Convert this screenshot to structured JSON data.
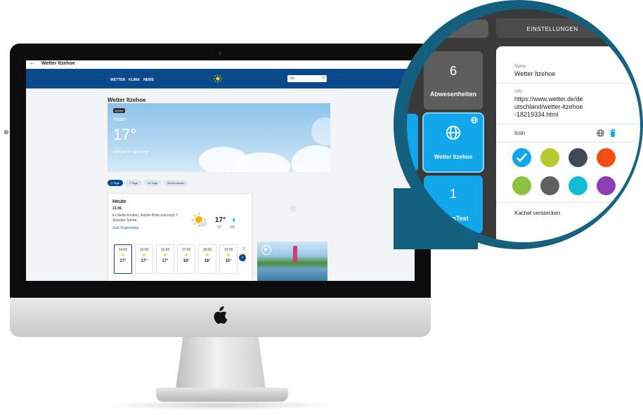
{
  "screen": {
    "topbar": {
      "back_icon": "arrow-left-icon",
      "title": "Wetter Itzehoe"
    },
    "nav": {
      "links": [
        "WETTER",
        "KLIMA",
        "NEWS"
      ],
      "logo_icon": "sun-icon",
      "search_placeholder": "Ort"
    },
    "page_title": "Wetter Itzehoe",
    "hero": {
      "badge": "● jetzt",
      "condition": "heiter",
      "temperature": "17°",
      "feels_like": "fühlt sich 4° wärmer an"
    },
    "chips": [
      "3 Tage",
      "7 Tage",
      "14 Tage",
      "Wochenende"
    ],
    "today": {
      "title": "Heute",
      "date": "13.06.",
      "description": "Es bleibt trocken, leichte Brise und noch 7 Stunden Sonne.",
      "link": "Zum Regenradar",
      "high": "17°",
      "low": "11°",
      "rain_chance": "0%"
    },
    "hours": [
      {
        "time": "14:00",
        "temp": "17°"
      },
      {
        "time": "15:00",
        "temp": "17°"
      },
      {
        "time": "16:00",
        "temp": "17°"
      },
      {
        "time": "17:00",
        "temp": "16°"
      },
      {
        "time": "18:00",
        "temp": "16°"
      },
      {
        "time": "19:00",
        "temp": "15°"
      },
      {
        "time": "2",
        "temp": "1"
      }
    ]
  },
  "magnifier": {
    "settings_tab": "EINSTELLUNGEN",
    "tiles": [
      {
        "number": "6",
        "label": "Abwesenheiten"
      },
      {
        "label": "Wetter Itzehoe",
        "icon": "globe-icon"
      },
      {
        "number": "1",
        "label": "nTest"
      }
    ],
    "panel": {
      "name_label": "Name",
      "name_value": "Wetter Itzehoe",
      "url_label": "URL",
      "url_value": "https://www.wetter.de/deutschland/wetter-itzehoe-18219334.html",
      "icon_label": "Icon",
      "hide_label": "Kachel verstecken"
    },
    "colors": [
      "#12a6ea",
      "#b5c930",
      "#3f4a57",
      "#f24d13",
      "#8ac13f",
      "#5f5f5f",
      "#12bcd4",
      "#8e3fb8"
    ]
  }
}
